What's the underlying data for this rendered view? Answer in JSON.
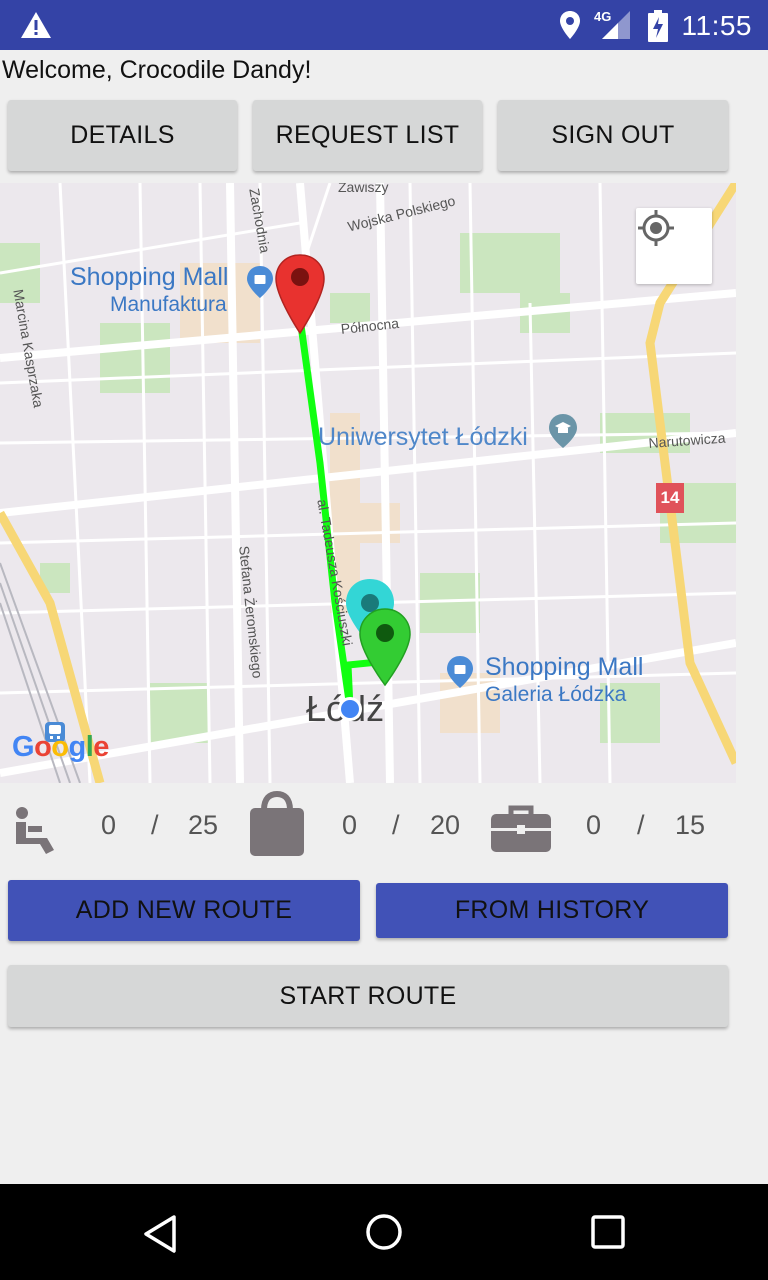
{
  "status_bar": {
    "network": "4G",
    "time": "11:55",
    "color": "#3443a6"
  },
  "welcome": "Welcome, Crocodile Dandy!",
  "top_buttons": {
    "details": "DETAILS",
    "request_list": "REQUEST LIST",
    "sign_out": "SIGN OUT"
  },
  "map": {
    "labels": {
      "poi1_name": "Shopping Mall",
      "poi1_sub": "Manufaktura",
      "poi2": "Uniwersytet Łódzki",
      "poi3_name": "Shopping Mall",
      "poi3_sub": "Galeria Łódzka",
      "city": "Łódź",
      "road_badge": "14"
    },
    "streets": {
      "zawiszy": "Zawiszy",
      "wojska": "Wojska Polskiego",
      "zachodnia": "Zachodnia",
      "polnocna": "Północna",
      "kasprzaka": "Marcina Kasprzaka",
      "narutowicza": "Narutowicza",
      "zeromskiego": "Stefana Żeromskiego",
      "kosciuszki": "al. Tadeusza Kościuszki"
    },
    "google": {
      "G": "G",
      "o1": "o",
      "o2": "o",
      "g": "g",
      "l": "l",
      "e": "e"
    },
    "colors": {
      "route": "#11ff11",
      "marker_start": "#e8322f",
      "marker_end": "#33cc33",
      "marker_mid": "#33d6d6"
    }
  },
  "capacity": {
    "seats": {
      "current": "0",
      "sep": "/",
      "max": "25"
    },
    "bags": {
      "current": "0",
      "sep": "/",
      "max": "20"
    },
    "cases": {
      "current": "0",
      "sep": "/",
      "max": "15"
    }
  },
  "actions": {
    "add_route": "ADD NEW ROUTE",
    "from_history": "FROM HISTORY",
    "start_route": "START ROUTE"
  }
}
